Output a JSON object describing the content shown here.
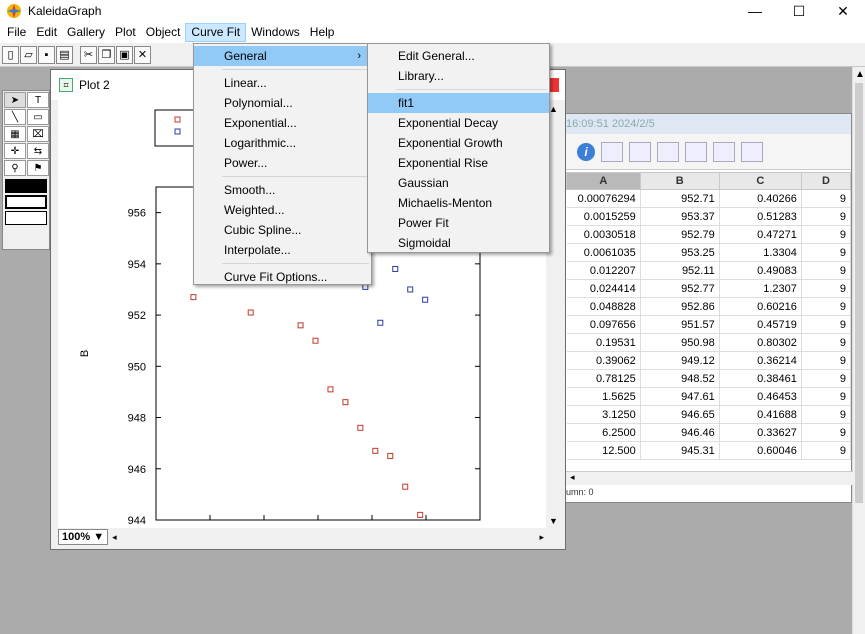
{
  "app": {
    "title": "KaleidaGraph"
  },
  "window_controls": {
    "minimize": "—",
    "maximize": "☐",
    "close": "✕"
  },
  "menubar": [
    "File",
    "Edit",
    "Gallery",
    "Plot",
    "Object",
    "Curve Fit",
    "Windows",
    "Help"
  ],
  "curve_fit_menu": {
    "items": [
      {
        "label": "General",
        "submenu": true
      },
      {
        "label": "Linear..."
      },
      {
        "label": "Polynomial..."
      },
      {
        "label": "Exponential..."
      },
      {
        "label": "Logarithmic..."
      },
      {
        "label": "Power..."
      },
      {
        "label": "Smooth..."
      },
      {
        "label": "Weighted..."
      },
      {
        "label": "Cubic Spline..."
      },
      {
        "label": "Interpolate..."
      },
      {
        "label": "Curve Fit Options..."
      }
    ],
    "submenu_arrow": "›"
  },
  "general_submenu": {
    "items": [
      "Edit General...",
      "Library...",
      "fit1",
      "Exponential Decay",
      "Exponential Growth",
      "Exponential Rise",
      "Gaussian",
      "Michaelis-Menton",
      "Power Fit",
      "Sigmoidal"
    ],
    "highlighted": "fit1"
  },
  "plot_window": {
    "title": "Plot 2",
    "zoom": "100%",
    "zoom_arrow": "▼",
    "ylabel": "B",
    "yticks": [
      944,
      946,
      948,
      950,
      952,
      954,
      956
    ]
  },
  "data_window": {
    "title": "16:09:51  2024/2/5",
    "info_icon": "i",
    "columns": [
      "A",
      "B",
      "C",
      "D"
    ],
    "rows": [
      [
        "0.00076294",
        "952.71",
        "0.40266",
        "9"
      ],
      [
        "0.0015259",
        "953.37",
        "0.51283",
        "9"
      ],
      [
        "0.0030518",
        "952.79",
        "0.47271",
        "9"
      ],
      [
        "0.0061035",
        "953.25",
        "1.3304",
        "9"
      ],
      [
        "0.012207",
        "952.11",
        "0.49083",
        "9"
      ],
      [
        "0.024414",
        "952.77",
        "1.2307",
        "9"
      ],
      [
        "0.048828",
        "952.86",
        "0.60216",
        "9"
      ],
      [
        "0.097656",
        "951.57",
        "0.45719",
        "9"
      ],
      [
        "0.19531",
        "950.98",
        "0.80302",
        "9"
      ],
      [
        "0.39062",
        "949.12",
        "0.36214",
        "9"
      ],
      [
        "0.78125",
        "948.52",
        "0.38461",
        "9"
      ],
      [
        "1.5625",
        "947.61",
        "0.46453",
        "9"
      ],
      [
        "3.1250",
        "946.65",
        "0.41688",
        "9"
      ],
      [
        "6.2500",
        "946.46",
        "0.33627",
        "9"
      ],
      [
        "12.500",
        "945.31",
        "0.60046",
        "9"
      ]
    ],
    "status": "umn: 0"
  },
  "chart_data": {
    "type": "scatter",
    "ylabel": "B",
    "ylim": [
      944,
      957
    ],
    "xlim": [
      0,
      13
    ],
    "yticks": [
      944,
      946,
      948,
      950,
      952,
      954,
      956
    ],
    "series": [
      {
        "color": "#c0392b",
        "points": [
          [
            1.5,
            952.7
          ],
          [
            3.8,
            952.1
          ],
          [
            5.8,
            951.6
          ],
          [
            6.4,
            951.0
          ],
          [
            7.0,
            949.1
          ],
          [
            7.6,
            948.6
          ],
          [
            8.2,
            947.6
          ],
          [
            8.8,
            946.7
          ],
          [
            9.4,
            946.5
          ],
          [
            10.0,
            945.3
          ],
          [
            10.6,
            944.2
          ]
        ]
      },
      {
        "color": "#2e3aa8",
        "points": [
          [
            8.4,
            953.1
          ],
          [
            9.0,
            951.7
          ],
          [
            9.6,
            953.8
          ],
          [
            10.2,
            953.0
          ],
          [
            10.8,
            952.6
          ]
        ]
      }
    ],
    "legend": "top-left"
  }
}
